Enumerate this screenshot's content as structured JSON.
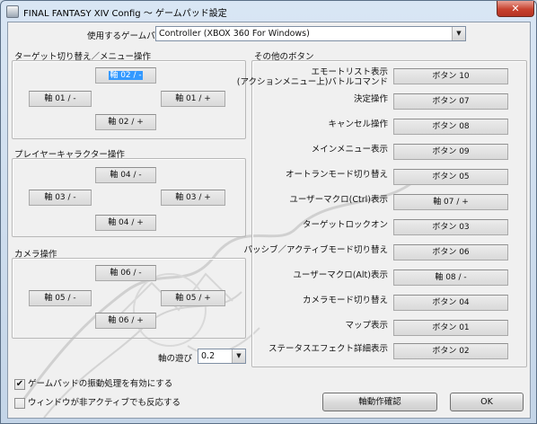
{
  "window": {
    "title": "FINAL FANTASY XIV Config ～ ゲームパッド設定",
    "close_glyph": "✕"
  },
  "gamepad_select": {
    "label": "使用するゲームパッド",
    "value": "Controller (XBOX 360 For Windows)",
    "arrow": "▼"
  },
  "groups": {
    "target": {
      "title": "ターゲット切り替え／メニュー操作",
      "up": "軸 02 / -",
      "left": "軸 01 / -",
      "right": "軸 01 / +",
      "down": "軸 02 / +"
    },
    "player": {
      "title": "プレイヤーキャラクター操作",
      "up": "軸 04 / -",
      "left": "軸 03 / -",
      "right": "軸 03 / +",
      "down": "軸 04 / +"
    },
    "camera": {
      "title": "カメラ操作",
      "up": "軸 06 / -",
      "left": "軸 05 / -",
      "right": "軸 05 / +",
      "down": "軸 06 / +"
    },
    "other": {
      "title": "その他のボタン",
      "rows": [
        {
          "label_line1": "エモートリスト表示",
          "label_line2": "(アクションメニュー上)バトルコマンド",
          "value": "ボタン 10"
        },
        {
          "label_line1": "決定操作",
          "value": "ボタン 07"
        },
        {
          "label_line1": "キャンセル操作",
          "value": "ボタン 08"
        },
        {
          "label_line1": "メインメニュー表示",
          "value": "ボタン 09"
        },
        {
          "label_line1": "オートランモード切り替え",
          "value": "ボタン 05"
        },
        {
          "label_line1": "ユーザーマクロ(Ctrl)表示",
          "value": "軸 07 / +"
        },
        {
          "label_line1": "ターゲットロックオン",
          "value": "ボタン 03"
        },
        {
          "label_line1": "パッシブ／アクティブモード切り替え",
          "value": "ボタン 06"
        },
        {
          "label_line1": "ユーザーマクロ(Alt)表示",
          "value": "軸 08 / -"
        },
        {
          "label_line1": "カメラモード切り替え",
          "value": "ボタン 04"
        },
        {
          "label_line1": "マップ表示",
          "value": "ボタン 01"
        },
        {
          "label_line1": "ステータスエフェクト詳細表示",
          "value": "ボタン 02"
        }
      ]
    }
  },
  "axis_play": {
    "label": "軸の遊び",
    "value": "0.2",
    "arrow": "▼"
  },
  "checkboxes": {
    "vibration": {
      "label": "ゲームパッドの振動処理を有効にする",
      "checked_glyph": "✔"
    },
    "inactive": {
      "label": "ウィンドウが非アクティブでも反応する",
      "checked_glyph": ""
    }
  },
  "buttons": {
    "axis_test": "軸動作確認",
    "ok": "OK"
  }
}
